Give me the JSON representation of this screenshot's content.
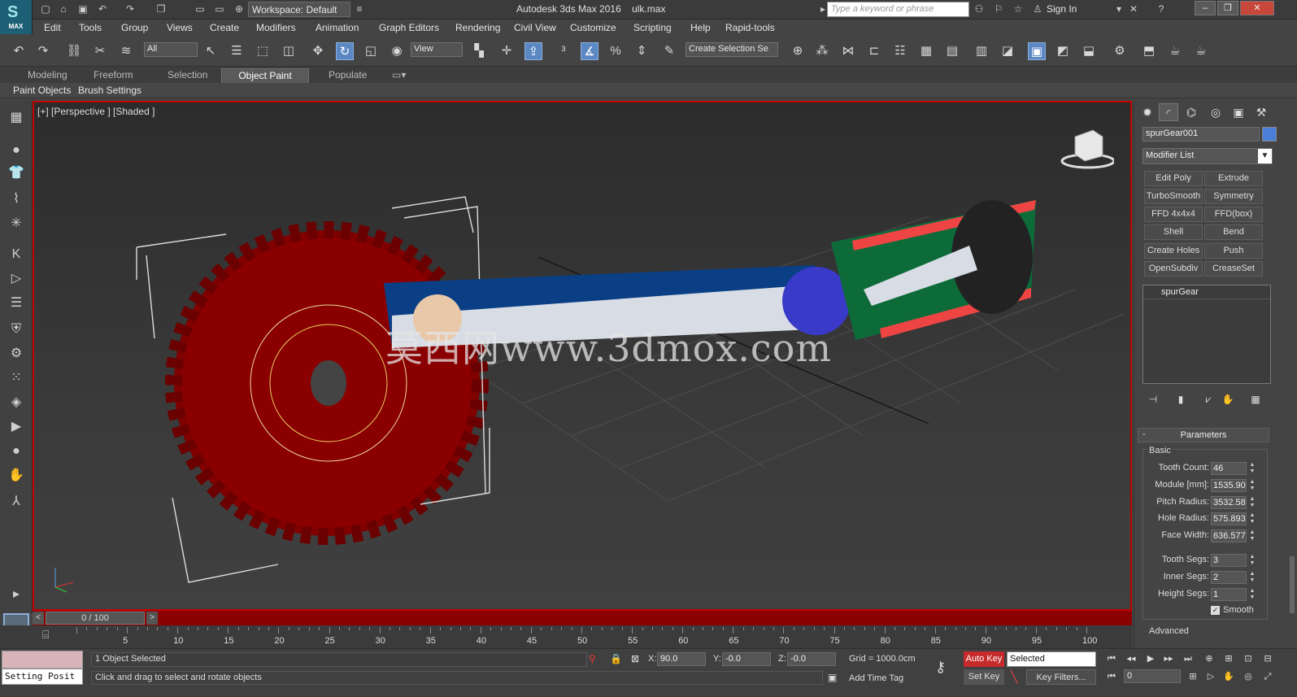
{
  "app": {
    "logo_text": "MAX",
    "title": "Autodesk 3ds Max 2016",
    "file": "ulk.max",
    "workspace": "Workspace: Default",
    "search_placeholder": "Type a keyword or phrase",
    "sign_in": "Sign In"
  },
  "menu": [
    "Edit",
    "Tools",
    "Group",
    "Views",
    "Create",
    "Modifiers",
    "Animation",
    "Graph Editors",
    "Rendering",
    "Civil View",
    "Customize",
    "Scripting",
    "Help",
    "Rapid-tools"
  ],
  "toolbar": {
    "filter": "All",
    "ref_coord": "View",
    "selection_set": "Create Selection Se"
  },
  "ribbon": {
    "tabs": [
      "Modeling",
      "Freeform",
      "Selection",
      "Object Paint",
      "Populate"
    ],
    "active_tab": "Object Paint",
    "sub_tabs": [
      "Paint Objects",
      "Brush Settings"
    ]
  },
  "viewport": {
    "label": "[+] [Perspective ] [Shaded ]",
    "watermark": "莫西网www.3dmox.com",
    "border_color": "#c40000",
    "gear_color": "#8a0000",
    "shaft_color": "#0a3f85"
  },
  "command_panel": {
    "object_name": "spurGear001",
    "object_color": "#4a7fd8",
    "modifier_list": "Modifier List",
    "modifier_buttons": [
      "Edit Poly",
      "Extrude",
      "TurboSmooth",
      "Symmetry",
      "FFD 4x4x4",
      "FFD(box)",
      "Shell",
      "Bend",
      "Create Holes",
      "Push",
      "OpenSubdiv",
      "CreaseSet"
    ],
    "stack_item": "spurGear",
    "rollout_title": "Parameters",
    "group_basic": "Basic",
    "params": [
      {
        "label": "Tooth Count:",
        "value": "46"
      },
      {
        "label": "Module [mm]:",
        "value": "1535.90"
      },
      {
        "label": "Pitch Radius:",
        "value": "3532.58"
      },
      {
        "label": "Hole Radius:",
        "value": "575.893"
      },
      {
        "label": "Face Width:",
        "value": "636.577"
      },
      {
        "label": "Tooth Segs:",
        "value": "3"
      },
      {
        "label": "Inner Segs:",
        "value": "2"
      },
      {
        "label": "Height Segs:",
        "value": "1"
      }
    ],
    "smooth_label": "Smooth",
    "smooth_checked": true,
    "group_advanced": "Advanced"
  },
  "timeline": {
    "frame_display": "0 / 100",
    "ticks": [
      "5",
      "10",
      "15",
      "20",
      "25",
      "30",
      "35",
      "40",
      "45",
      "50",
      "55",
      "60",
      "65",
      "70",
      "75",
      "80",
      "85",
      "90",
      "95",
      "100"
    ]
  },
  "status": {
    "maxscript": "Setting Posit",
    "selected": "1 Object Selected",
    "prompt": "Click and drag to select and rotate objects",
    "x_label": "X:",
    "x": "90.0",
    "y_label": "Y:",
    "y": "-0.0",
    "z_label": "Z:",
    "z": "-0.0",
    "grid": "Grid = 1000.0cm",
    "add_time_tag": "Add Time Tag",
    "auto_key": "Auto Key",
    "set_key": "Set Key",
    "key_mode": "Selected",
    "key_filters": "Key Filters...",
    "frame": "0"
  }
}
